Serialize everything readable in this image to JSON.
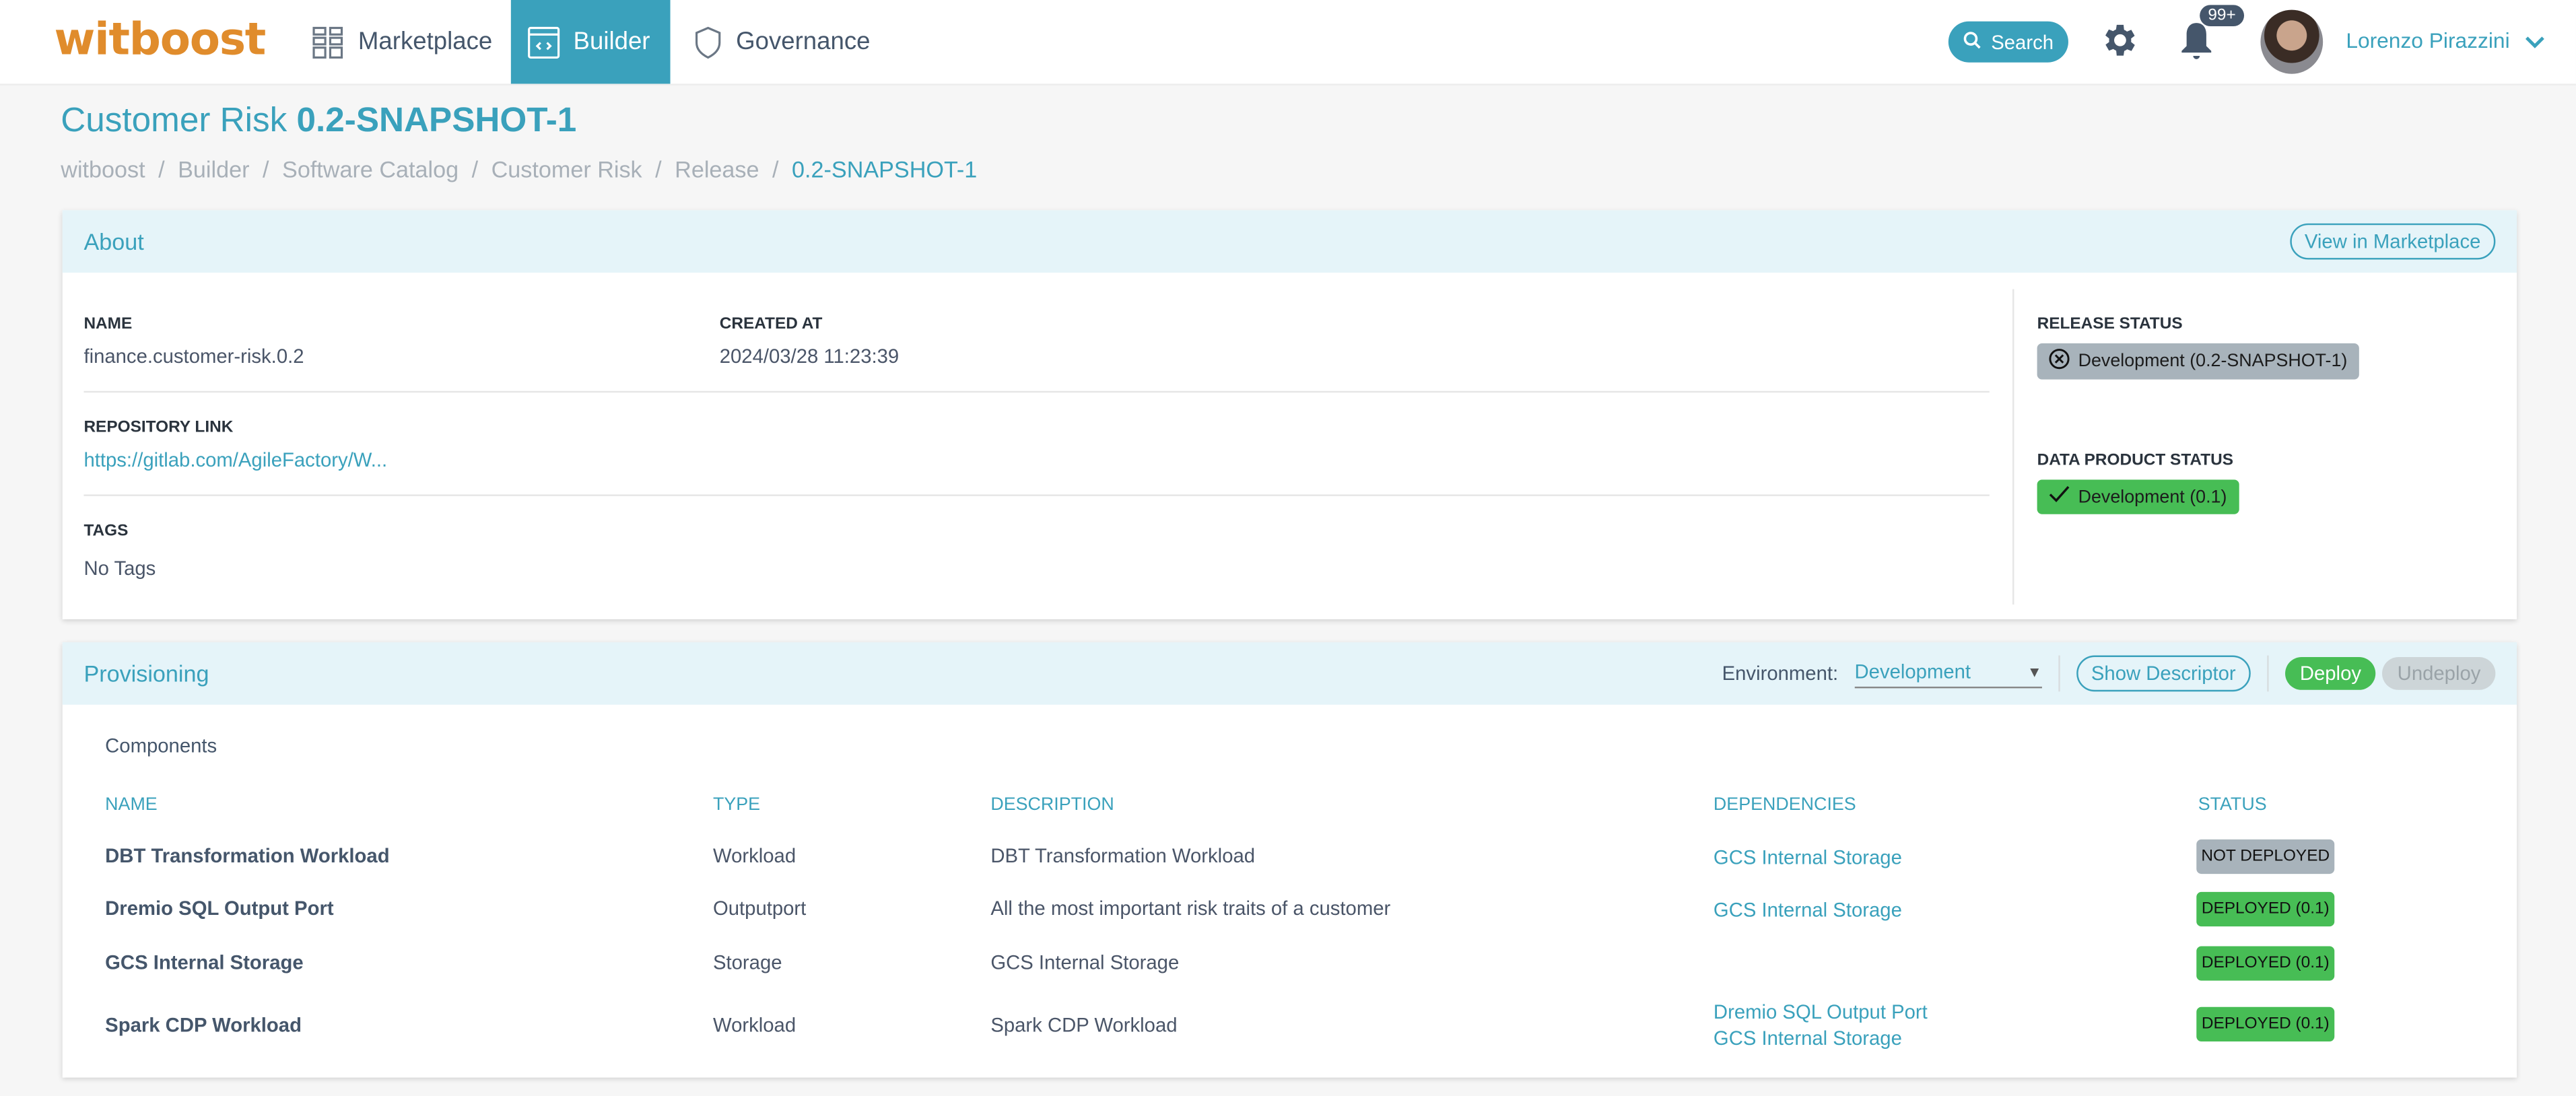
{
  "topbar": {
    "logo": "witboost",
    "nav": [
      {
        "label": "Marketplace",
        "icon": "grid-icon",
        "active": false
      },
      {
        "label": "Builder",
        "icon": "code-icon",
        "active": true
      },
      {
        "label": "Governance",
        "icon": "shield-icon",
        "active": false
      }
    ],
    "search_label": "Search",
    "notification_count": "99+",
    "user_name": "Lorenzo Pirazzini"
  },
  "page": {
    "title_name": "Customer Risk",
    "title_version": "0.2-SNAPSHOT-1",
    "breadcrumb": [
      "witboost",
      "Builder",
      "Software Catalog",
      "Customer Risk",
      "Release",
      "0.2-SNAPSHOT-1"
    ]
  },
  "about": {
    "title": "About",
    "view_marketplace": "View in Marketplace",
    "name_label": "NAME",
    "name_value": "finance.customer-risk.0.2",
    "created_label": "CREATED AT",
    "created_value": "2024/03/28 11:23:39",
    "repo_label": "REPOSITORY LINK",
    "repo_value": "https://gitlab.com/AgileFactory/W...",
    "tags_label": "TAGS",
    "tags_value": "No Tags",
    "release_status_label": "RELEASE STATUS",
    "release_status_value": "Development (0.2-SNAPSHOT-1)",
    "dp_status_label": "DATA PRODUCT STATUS",
    "dp_status_value": "Development (0.1)"
  },
  "provisioning": {
    "title": "Provisioning",
    "env_label": "Environment:",
    "env_value": "Development",
    "show_descriptor": "Show Descriptor",
    "deploy": "Deploy",
    "undeploy": "Undeploy",
    "components_title": "Components",
    "columns": [
      "NAME",
      "TYPE",
      "DESCRIPTION",
      "DEPENDENCIES",
      "STATUS"
    ],
    "rows": [
      {
        "name": "DBT Transformation Workload",
        "type": "Workload",
        "description": "DBT Transformation Workload",
        "dependencies": [
          "GCS Internal Storage"
        ],
        "status": "NOT DEPLOYED",
        "deployed": false
      },
      {
        "name": "Dremio SQL Output Port",
        "type": "Outputport",
        "description": "All the most important risk traits of a customer",
        "dependencies": [
          "GCS Internal Storage"
        ],
        "status": "DEPLOYED (0.1)",
        "deployed": true
      },
      {
        "name": "GCS Internal Storage",
        "type": "Storage",
        "description": "GCS Internal Storage",
        "dependencies": [],
        "status": "DEPLOYED (0.1)",
        "deployed": true
      },
      {
        "name": "Spark CDP Workload",
        "type": "Workload",
        "description": "Spark CDP Workload",
        "dependencies": [
          "Dremio SQL Output Port",
          "GCS Internal Storage"
        ],
        "status": "DEPLOYED (0.1)",
        "deployed": true
      }
    ]
  },
  "colors": {
    "accent": "#3aa1bc",
    "brand": "#e08c2c",
    "success": "#47bd55",
    "neutral": "#a8b3bb"
  }
}
